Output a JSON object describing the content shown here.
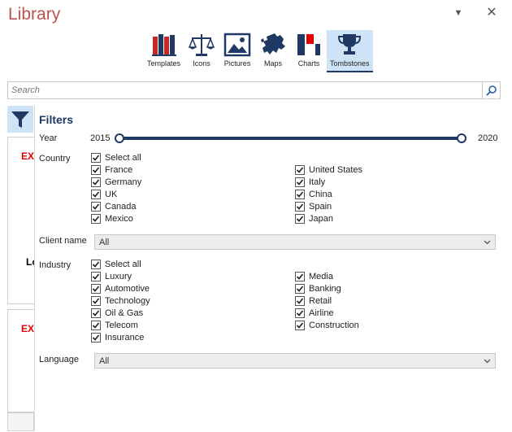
{
  "window": {
    "title": "Library"
  },
  "toolbar": {
    "items": [
      {
        "label": "Templates"
      },
      {
        "label": "Icons"
      },
      {
        "label": "Pictures"
      },
      {
        "label": "Maps"
      },
      {
        "label": "Charts"
      },
      {
        "label": "Tombstones",
        "active": true
      }
    ]
  },
  "search": {
    "placeholder": "Search"
  },
  "background": {
    "card1_text": "EX",
    "card1_text2": "Lo",
    "card2_text": "EX"
  },
  "filters": {
    "title": "Filters",
    "year": {
      "label": "Year",
      "min": "2015",
      "max": "2020"
    },
    "country": {
      "label": "Country",
      "select_all": "Select all",
      "left": [
        "France",
        "Germany",
        "UK",
        "Canada",
        "Mexico"
      ],
      "right": [
        "United States",
        "Italy",
        "China",
        "Spain",
        "Japan"
      ]
    },
    "client_name": {
      "label": "Client name",
      "value": "All"
    },
    "industry": {
      "label": "Industry",
      "select_all": "Select all",
      "left": [
        "Luxury",
        "Automotive",
        "Technology",
        "Oil & Gas",
        "Telecom",
        "Insurance"
      ],
      "right": [
        "Media",
        "Banking",
        "Retail",
        "Airline",
        "Construction"
      ]
    },
    "language": {
      "label": "Language",
      "value": "All"
    }
  },
  "colors": {
    "title": "#c0504d",
    "accent": "#1f3864",
    "active_bg": "#cfe3f7",
    "red": "#e00000"
  }
}
